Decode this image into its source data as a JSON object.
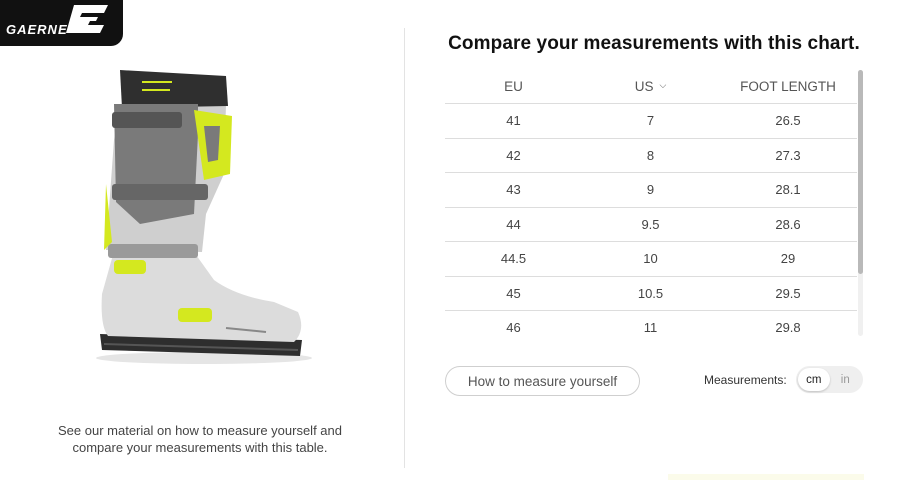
{
  "brand": {
    "logo_text": "GAERNE"
  },
  "left_panel": {
    "description": "See our material on how to measure yourself and compare your measurements with this table."
  },
  "chart": {
    "title": "Compare your measurements with this chart.",
    "columns": {
      "eu": "EU",
      "us": "US",
      "foot_length": "FOOT LENGTH"
    },
    "rows": [
      {
        "eu": "41",
        "us": "7",
        "foot": "26.5"
      },
      {
        "eu": "42",
        "us": "8",
        "foot": "27.3"
      },
      {
        "eu": "43",
        "us": "9",
        "foot": "28.1"
      },
      {
        "eu": "44",
        "us": "9.5",
        "foot": "28.6"
      },
      {
        "eu": "44.5",
        "us": "10",
        "foot": "29"
      },
      {
        "eu": "45",
        "us": "10.5",
        "foot": "29.5"
      },
      {
        "eu": "46",
        "us": "11",
        "foot": "29.8"
      }
    ]
  },
  "controls": {
    "measure_button": "How to measure yourself",
    "measurements_label": "Measurements:",
    "unit_cm": "cm",
    "unit_in": "in",
    "selected_unit": "cm"
  },
  "colors": {
    "accent_yellow": "#d4e81f",
    "boot_gray": "#7a7a7a",
    "boot_white": "#e8e8e8"
  }
}
